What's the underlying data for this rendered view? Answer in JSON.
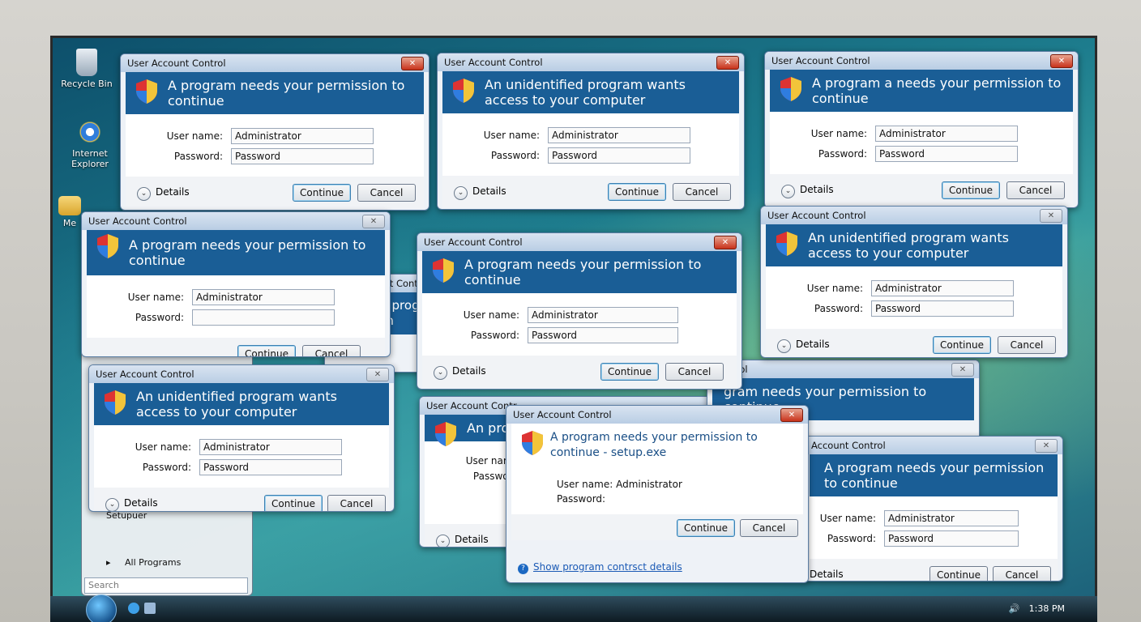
{
  "desktop": {
    "icons": [
      {
        "label": "Recycle Bin",
        "icon": "recycle-bin-icon"
      },
      {
        "label": "Internet Explorer",
        "icon": "internet-explorer-icon"
      },
      {
        "label": "Me",
        "icon": "folder-icon"
      }
    ]
  },
  "dialog_common": {
    "title": "User Account Control",
    "username_label": "User name:",
    "password_label": "Password:",
    "username_value": "Administrator",
    "password_placeholder": "Password",
    "details_label": "Details",
    "continue_label": "Continue",
    "cancel_label": "Cancel"
  },
  "dialogs": [
    {
      "title": "User Account Control",
      "heading": "A program needs your permission to continue"
    },
    {
      "title": "User Account Control",
      "heading": "An unidentified program wants access to your computer"
    },
    {
      "title": "User Account Control",
      "heading": "A program a needs your permission to continue"
    },
    {
      "title": "User Account Control",
      "heading": "A program needs your permission to continue"
    },
    {
      "title": "User Account Control",
      "heading": "An unidentified program wants access to your computer"
    },
    {
      "title": "User Account Control",
      "heading": "A program needs your permission to continue"
    },
    {
      "title": "User Account Control",
      "heading": "An unidentified program wants access to your computer"
    },
    {
      "title": "User Account Control",
      "heading": "A program needs your permission to continue - setup.exe",
      "username_inline": "Administrator",
      "link": "Show program contrsct details"
    },
    {
      "title": "Account Control",
      "heading": "A program needs your permission to continue"
    },
    {
      "title": "User Account Contro",
      "heading": "An progr your con"
    },
    {
      "title": "User Account Contr",
      "heading": "An prog your co"
    },
    {
      "title": "Control",
      "heading": "gram needs your permission to continue"
    }
  ],
  "start_menu": {
    "setup_item": "Setupuer",
    "all_programs": "All Programs",
    "search_placeholder": "Search"
  },
  "taskbar": {
    "clock": "1:38 PM"
  },
  "colors": {
    "uac_banner": "#1a5e96",
    "close_button": "#c8321b"
  }
}
